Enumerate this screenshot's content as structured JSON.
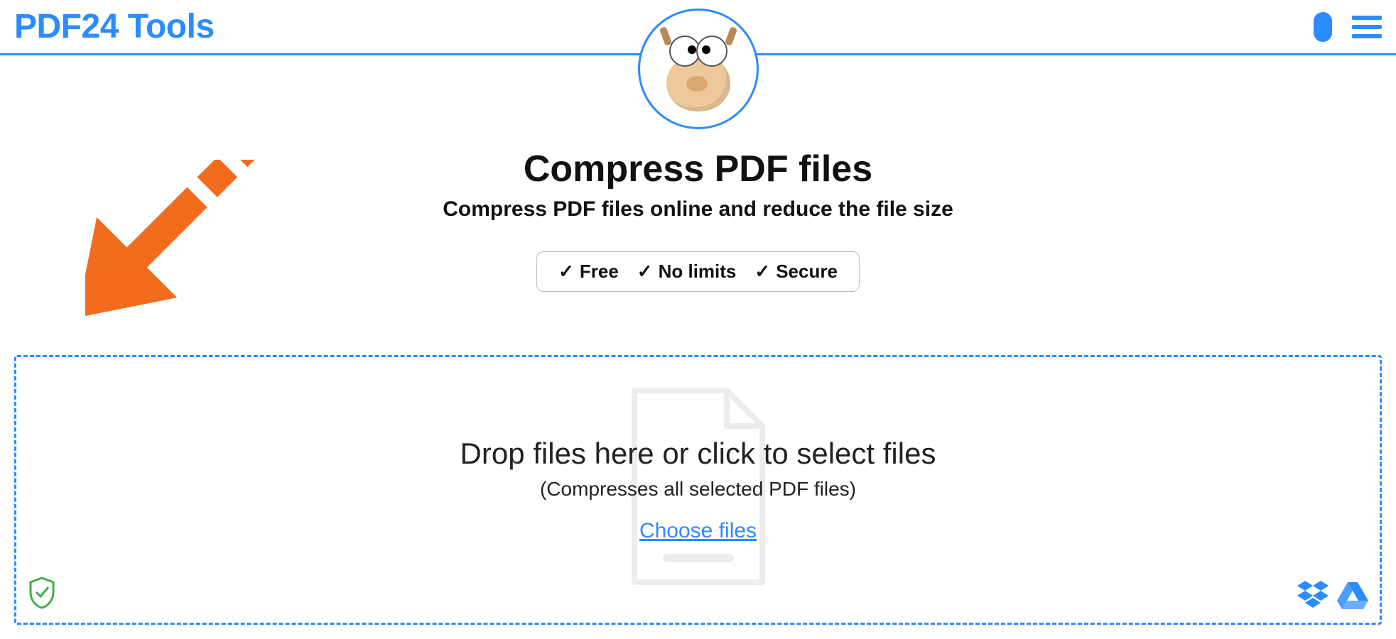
{
  "header": {
    "logo": "PDF24 Tools"
  },
  "page": {
    "title": "Compress PDF files",
    "subtitle": "Compress PDF files online and reduce the file size"
  },
  "badges": {
    "free": "Free",
    "nolimits": "No limits",
    "secure": "Secure"
  },
  "dropzone": {
    "title": "Drop files here or click to select files",
    "subtitle": "(Compresses all selected PDF files)",
    "choose": "Choose files"
  }
}
